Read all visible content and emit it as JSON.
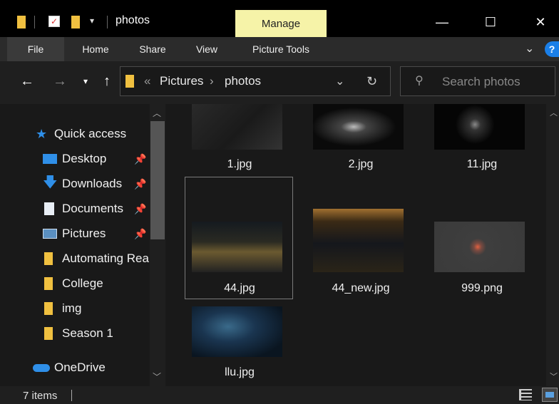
{
  "window": {
    "title": "photos",
    "manage_label": "Manage"
  },
  "ribbon": {
    "tabs": [
      "File",
      "Home",
      "Share",
      "View",
      "Picture Tools"
    ]
  },
  "address": {
    "overflow": "«",
    "crumbs": [
      "Pictures",
      "photos"
    ],
    "separator": "›"
  },
  "search": {
    "placeholder": "Search photos"
  },
  "sidebar": {
    "quick_access": "Quick access",
    "items": [
      {
        "label": "Desktop",
        "icon": "desktop-icon",
        "pinned": true
      },
      {
        "label": "Downloads",
        "icon": "download-arrow-icon",
        "pinned": true
      },
      {
        "label": "Documents",
        "icon": "document-icon",
        "pinned": true
      },
      {
        "label": "Pictures",
        "icon": "pictures-icon",
        "pinned": true
      },
      {
        "label": "Automating Rea",
        "icon": "folder-icon",
        "pinned": false
      },
      {
        "label": "College",
        "icon": "folder-icon",
        "pinned": false
      },
      {
        "label": "img",
        "icon": "folder-icon",
        "pinned": false
      },
      {
        "label": "Season 1",
        "icon": "folder-icon",
        "pinned": false
      }
    ],
    "onedrive": "OneDrive"
  },
  "files": [
    {
      "name": "1.jpg"
    },
    {
      "name": "2.jpg"
    },
    {
      "name": "11.jpg"
    },
    {
      "name": "44.jpg",
      "selected": true
    },
    {
      "name": "44_new.jpg"
    },
    {
      "name": "999.png"
    },
    {
      "name": "llu.jpg"
    }
  ],
  "status": {
    "item_count": "7 items"
  },
  "colors": {
    "accent_manage": "#f6f3a8",
    "folder_yellow": "#f0c040",
    "star_blue": "#2f8fe8",
    "help_blue": "#1a7fe8"
  }
}
